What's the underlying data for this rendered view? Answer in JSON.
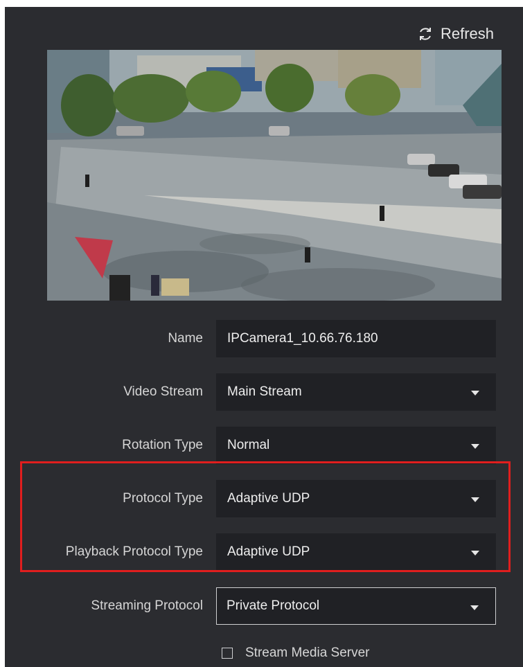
{
  "header": {
    "refresh_label": "Refresh",
    "refresh_icon": "refresh-icon"
  },
  "preview": {
    "description_icon": "camera-preview-image"
  },
  "form": {
    "name": {
      "label": "Name",
      "value": "IPCamera1_10.66.76.180"
    },
    "video_stream": {
      "label": "Video Stream",
      "value": "Main Stream"
    },
    "rotation_type": {
      "label": "Rotation Type",
      "value": "Normal"
    },
    "protocol_type": {
      "label": "Protocol Type",
      "value": "Adaptive UDP"
    },
    "playback_protocol_type": {
      "label": "Playback Protocol Type",
      "value": "Adaptive UDP"
    },
    "streaming_protocol": {
      "label": "Streaming Protocol",
      "value": "Private Protocol"
    },
    "stream_media_server": {
      "label": "Stream Media Server",
      "checked": false
    }
  },
  "colors": {
    "panel_bg": "#2b2c30",
    "field_bg": "#202125",
    "highlight": "#e01e1e"
  }
}
